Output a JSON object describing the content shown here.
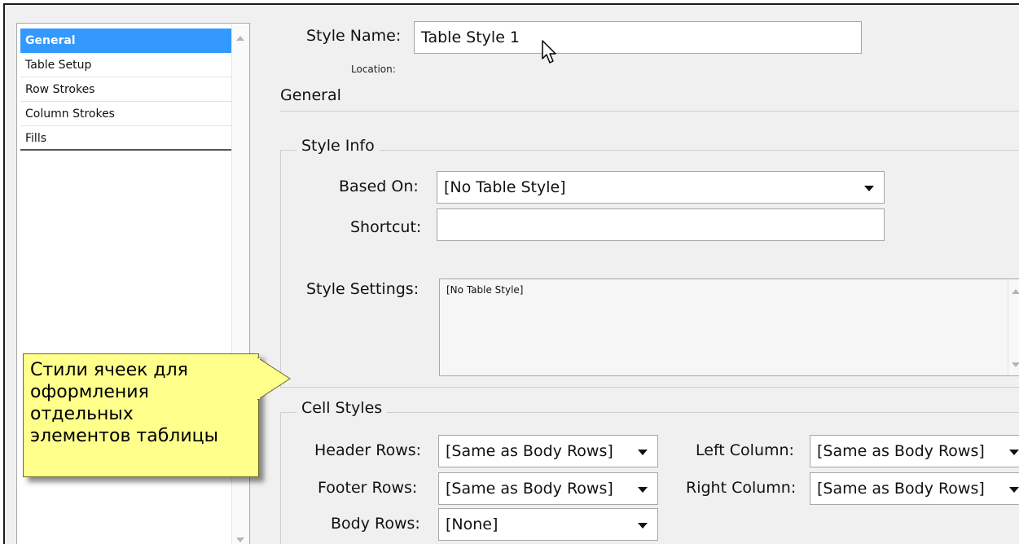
{
  "sidebar": {
    "items": [
      {
        "label": "General"
      },
      {
        "label": "Table Setup"
      },
      {
        "label": "Row Strokes"
      },
      {
        "label": "Column Strokes"
      },
      {
        "label": "Fills"
      }
    ]
  },
  "header": {
    "style_name_label": "Style Name:",
    "style_name_value": "Table Style 1",
    "location_label": "Location:",
    "section_title": "General"
  },
  "style_info": {
    "title": "Style Info",
    "based_on_label": "Based On:",
    "based_on_value": "[No Table Style]",
    "shortcut_label": "Shortcut:",
    "shortcut_value": "",
    "style_settings_label": "Style Settings:",
    "style_settings_value": "[No Table Style]"
  },
  "cell_styles": {
    "title": "Cell Styles",
    "header_rows_label": "Header Rows:",
    "header_rows_value": "[Same as Body Rows]",
    "footer_rows_label": "Footer Rows:",
    "footer_rows_value": "[Same as Body Rows]",
    "body_rows_label": "Body Rows:",
    "body_rows_value": "[None]",
    "left_column_label": "Left Column:",
    "left_column_value": "[Same as Body Rows]",
    "right_column_label": "Right Column:",
    "right_column_value": "[Same as Body Rows]"
  },
  "callout": {
    "lines": [
      "Стили ячеек для",
      "оформления",
      "отдельных",
      "элементов таблицы"
    ]
  },
  "colors": {
    "selection": "#3399ff",
    "callout_fill": "#ffff8c",
    "dialog_bg": "#f0f0f0"
  },
  "icons": [
    "mouse-pointer-icon",
    "scroll-up-icon",
    "scroll-down-icon",
    "dropdown-caret-icon"
  ]
}
